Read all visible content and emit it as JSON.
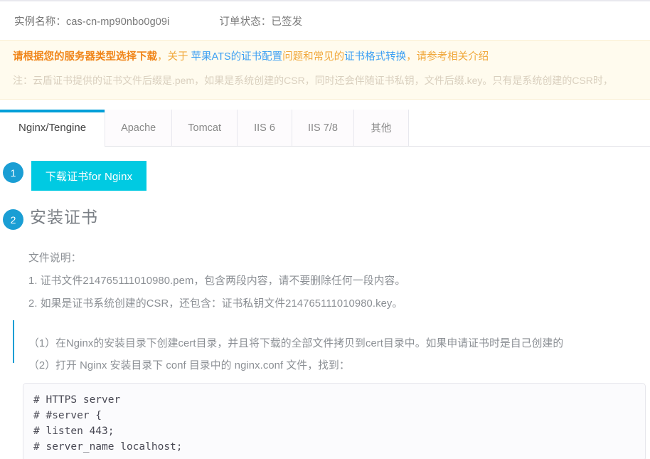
{
  "header": {
    "instance_label": "实例名称：",
    "instance_value": "cas-cn-mp90nbo0g09i",
    "order_label": "订单状态：",
    "order_value": "已签发"
  },
  "notice": {
    "strong": "请根据您的服务器类型选择下载",
    "sep1": "，关于 ",
    "link1": "苹果ATS的证书配置",
    "mid": "问题和常见的",
    "link2": "证书格式转换",
    "tail": "，请参考相关介绍",
    "note": "注：云盾证书提供的证书文件后缀是.pem，如果是系统创建的CSR，同时还会伴随证书私钥，文件后缀.key。只有是系统创建的CSR时，",
    "bg_color": "#fffbee",
    "strong_color": "#f08519",
    "link_color": "#3b9ff3"
  },
  "tabs": {
    "active_index": 0,
    "items": [
      {
        "label": "Nginx/Tengine"
      },
      {
        "label": "Apache"
      },
      {
        "label": "Tomcat"
      },
      {
        "label": "IIS 6"
      },
      {
        "label": "IIS 7/8"
      },
      {
        "label": "其他"
      }
    ],
    "active_accent": "#009fd9"
  },
  "steps": {
    "one": "1",
    "two": "2",
    "accent": "#1a9ed4"
  },
  "main": {
    "download_button": "下载证书for Nginx",
    "download_button_color": "#00cae2",
    "section_title": "安装证书",
    "file_desc_label": "文件说明：",
    "file_item_1": "1. 证书文件214765111010980.pem，包含两段内容，请不要删除任何一段内容。",
    "file_item_2": "2. 如果是证书系统创建的CSR，还包含：证书私钥文件214765111010980.key。",
    "para_1": "（1）在Nginx的安装目录下创建cert目录，并且将下载的全部文件拷贝到cert目录中。如果申请证书时是自己创建的",
    "para_2": "（2）打开 Nginx 安装目录下 conf 目录中的 nginx.conf 文件，找到："
  },
  "code": {
    "line_1": "# HTTPS server",
    "line_2": "# #server {",
    "line_3": "# listen 443;",
    "line_4": "# server_name localhost;"
  }
}
